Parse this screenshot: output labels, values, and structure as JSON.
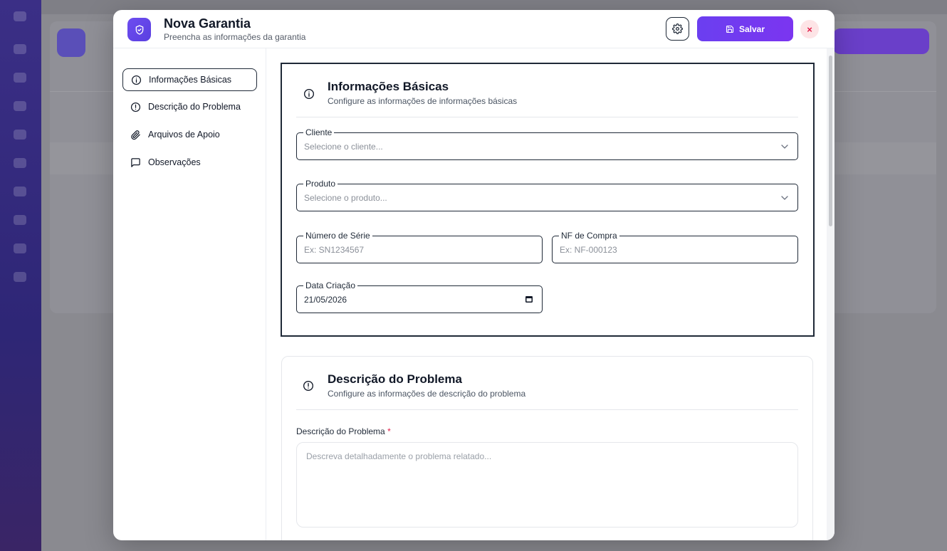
{
  "modal": {
    "title": "Nova Garantia",
    "subtitle": "Preencha as informações da garantia",
    "save_label": "Salvar",
    "close_label": "×"
  },
  "nav": {
    "items": [
      {
        "label": "Informações Básicas",
        "icon": "info-icon"
      },
      {
        "label": "Descrição do Problema",
        "icon": "alert-circle-icon"
      },
      {
        "label": "Arquivos de Apoio",
        "icon": "paperclip-icon"
      },
      {
        "label": "Observações",
        "icon": "message-square-icon"
      }
    ]
  },
  "section_basic": {
    "title": "Informações Básicas",
    "description": "Configure as informações de informações básicas",
    "cliente": {
      "label": "Cliente",
      "placeholder": "Selecione o cliente..."
    },
    "produto": {
      "label": "Produto",
      "placeholder": "Selecione o produto..."
    },
    "serie": {
      "label": "Número de Série",
      "placeholder": "Ex: SN1234567"
    },
    "nf": {
      "label": "NF de Compra",
      "placeholder": "Ex: NF-000123"
    },
    "data": {
      "label": "Data Criação",
      "value": "21/05/2026"
    }
  },
  "section_problem": {
    "title": "Descrição do Problema",
    "description": "Configure as informações de descrição do problema",
    "field_label": "Descrição do Problema",
    "required_mark": "*",
    "placeholder": "Descreva detalhadamente o problema relatado..."
  },
  "colors": {
    "accent": "#6b3ff0",
    "danger": "#e11d48"
  }
}
